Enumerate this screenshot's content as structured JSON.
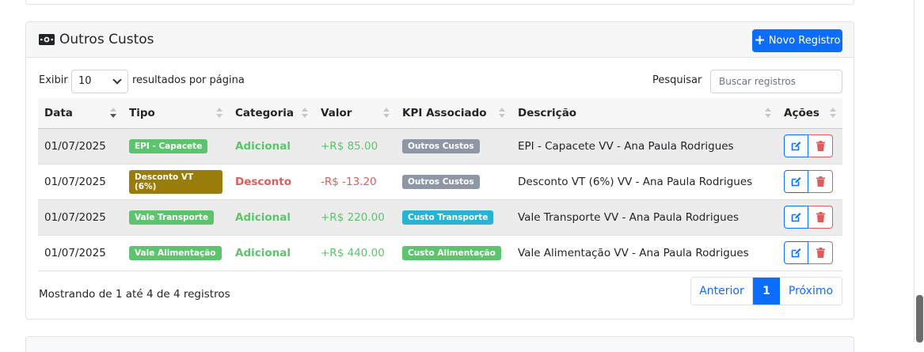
{
  "card": {
    "title": "Outros Custos",
    "new_button": "Novo Registro"
  },
  "controls": {
    "show_label": "Exibir",
    "page_size": "10",
    "per_page_label": "resultados por página",
    "search_label": "Pesquisar",
    "search_placeholder": "Buscar registros"
  },
  "table": {
    "headers": [
      "Data",
      "Tipo",
      "Categoria",
      "Valor",
      "KPI Associado",
      "Descrição",
      "Ações"
    ],
    "rows": [
      {
        "date": "01/07/2025",
        "tipo": "EPI - Capacete",
        "tipo_color": "#5cc46c",
        "categoria": "Adicional",
        "valor": "+R$ 85.00",
        "kpi": "Outros Custos",
        "kpi_color": "#8d97a6",
        "descricao": "EPI - Capacete VV - Ana Paula Rodrigues"
      },
      {
        "date": "01/07/2025",
        "tipo": "Desconto VT (6%)",
        "tipo_color": "#9a7c0b",
        "categoria": "Desconto",
        "valor": "-R$ -13.20",
        "kpi": "Outros Custos",
        "kpi_color": "#8d97a6",
        "descricao": "Desconto VT (6%) VV - Ana Paula Rodrigues"
      },
      {
        "date": "01/07/2025",
        "tipo": "Vale Transporte",
        "tipo_color": "#5cc46c",
        "categoria": "Adicional",
        "valor": "+R$ 220.00",
        "kpi": "Custo Transporte",
        "kpi_color": "#26b3d6",
        "descricao": "Vale Transporte VV - Ana Paula Rodrigues"
      },
      {
        "date": "01/07/2025",
        "tipo": "Vale Alimentação",
        "tipo_color": "#5cc46c",
        "categoria": "Adicional",
        "valor": "+R$ 440.00",
        "kpi": "Custo Alimentação",
        "kpi_color": "#5cc46c",
        "descricao": "Vale Alimentação VV - Ana Paula Rodrigues"
      }
    ]
  },
  "footer": {
    "info": "Mostrando de 1 até 4 de 4 registros",
    "prev": "Anterior",
    "current_page": "1",
    "next": "Próximo"
  },
  "colors": {
    "primary": "#0d6efd",
    "success": "#5cc46c",
    "danger": "#e15b5b"
  }
}
